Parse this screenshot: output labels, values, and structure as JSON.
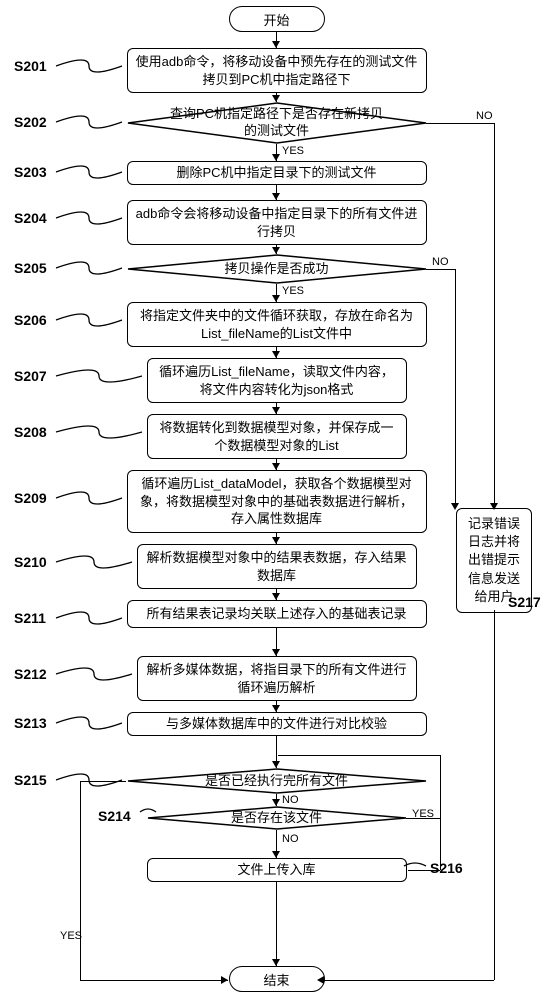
{
  "terminators": {
    "start": "开始",
    "end": "结束"
  },
  "steps": {
    "s201": {
      "label": "S201",
      "text": "使用adb命令，将移动设备中预先存在的测试文件拷贝到PC机中指定路径下"
    },
    "s202": {
      "label": "S202",
      "text": "查询PC机指定路径下是否存在新拷贝的测试文件"
    },
    "s203": {
      "label": "S203",
      "text": "删除PC机中指定目录下的测试文件"
    },
    "s204": {
      "label": "S204",
      "text": "adb命令会将移动设备中指定目录下的所有文件进行拷贝"
    },
    "s205": {
      "label": "S205",
      "text": "拷贝操作是否成功"
    },
    "s206": {
      "label": "S206",
      "text": "将指定文件夹中的文件循环获取，存放在命名为List_fileName的List文件中"
    },
    "s207": {
      "label": "S207",
      "text": "循环遍历List_fileName，读取文件内容，将文件内容转化为json格式"
    },
    "s208": {
      "label": "S208",
      "text": "将数据转化到数据模型对象，并保存成一个数据模型对象的List"
    },
    "s209": {
      "label": "S209",
      "text": "循环遍历List_dataModel，获取各个数据模型对象，将数据模型对象中的基础表数据进行解析，存入属性数据库"
    },
    "s210": {
      "label": "S210",
      "text": "解析数据模型对象中的结果表数据，存入结果数据库"
    },
    "s211": {
      "label": "S211",
      "text": "所有结果表记录均关联上述存入的基础表记录"
    },
    "s212": {
      "label": "S212",
      "text": "解析多媒体数据，将指目录下的所有文件进行循环遍历解析"
    },
    "s213": {
      "label": "S213",
      "text": "与多媒体数据库中的文件进行对比校验"
    },
    "s214": {
      "label": "S214",
      "text": "是否存在该文件"
    },
    "s215": {
      "label": "S215",
      "text": "是否已经执行完所有文件"
    },
    "s216": {
      "label": "S216",
      "text": "文件上传入库"
    },
    "s217": {
      "label": "S217",
      "text": "记录错误日志并将出错提示信息发送给用户"
    }
  },
  "edges": {
    "yes": "YES",
    "no": "NO"
  }
}
